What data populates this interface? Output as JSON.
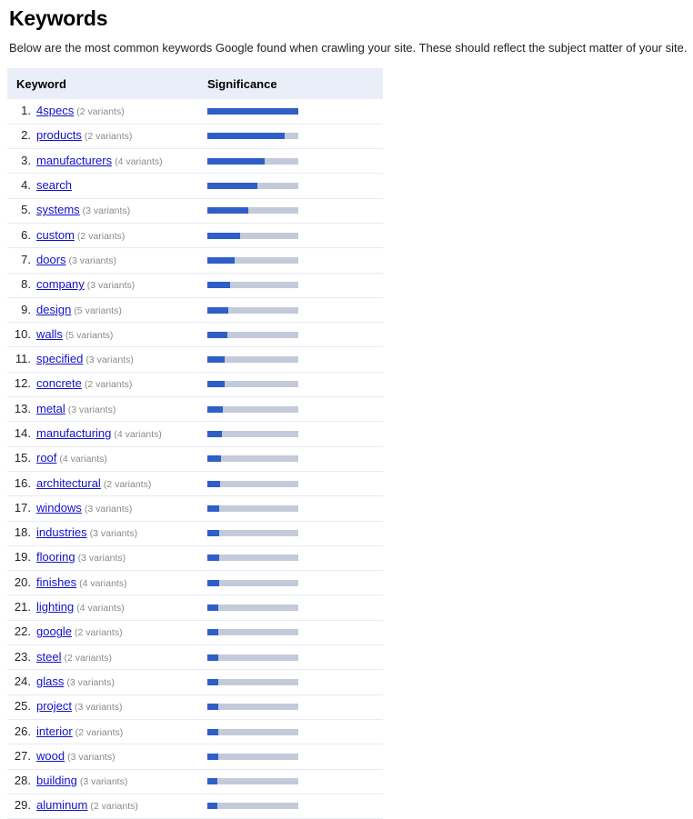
{
  "page": {
    "title": "Keywords",
    "description": "Below are the most common keywords Google found when crawling your site. These should reflect the subject matter of your site."
  },
  "table": {
    "columns": [
      "Keyword",
      "Significance"
    ],
    "variants_suffix": "variants",
    "colors": {
      "bar_fill": "#2f5fc6",
      "bar_track": "#c3cada",
      "header_background": "#eaeef8",
      "link": "#1111cc",
      "variants_text": "#8a8a8a"
    }
  },
  "chart_data": {
    "type": "bar",
    "title": "Keywords",
    "xlabel": "Significance",
    "ylabel": "Keyword",
    "ylim": [
      0,
      100
    ],
    "grid": false,
    "legend": null,
    "orientation": "horizontal",
    "categories": [
      "4specs",
      "products",
      "manufacturers",
      "search",
      "systems",
      "custom",
      "doors",
      "company",
      "design",
      "walls",
      "specified",
      "concrete",
      "metal",
      "manufacturing",
      "roof",
      "architectural",
      "windows",
      "industries",
      "flooring",
      "finishes",
      "lighting",
      "google",
      "steel",
      "glass",
      "project",
      "interior",
      "wood",
      "building",
      "aluminum"
    ],
    "values": [
      100,
      85,
      63,
      55,
      45,
      36,
      30,
      25,
      23,
      22,
      19,
      19,
      17,
      16,
      15,
      14,
      13,
      13,
      12.5,
      12.5,
      12,
      12,
      12,
      12,
      11.5,
      11.5,
      11.5,
      11,
      11
    ]
  },
  "rows": [
    {
      "rank": "1.",
      "keyword": "4specs",
      "variants": "(2 variants)",
      "significance": 100
    },
    {
      "rank": "2.",
      "keyword": "products",
      "variants": "(2 variants)",
      "significance": 85
    },
    {
      "rank": "3.",
      "keyword": "manufacturers",
      "variants": "(4 variants)",
      "significance": 63
    },
    {
      "rank": "4.",
      "keyword": "search",
      "variants": "",
      "significance": 55
    },
    {
      "rank": "5.",
      "keyword": "systems",
      "variants": "(3 variants)",
      "significance": 45
    },
    {
      "rank": "6.",
      "keyword": "custom",
      "variants": "(2 variants)",
      "significance": 36
    },
    {
      "rank": "7.",
      "keyword": "doors",
      "variants": "(3 variants)",
      "significance": 30
    },
    {
      "rank": "8.",
      "keyword": "company",
      "variants": "(3 variants)",
      "significance": 25
    },
    {
      "rank": "9.",
      "keyword": "design",
      "variants": "(5 variants)",
      "significance": 23
    },
    {
      "rank": "10.",
      "keyword": "walls",
      "variants": "(5 variants)",
      "significance": 22
    },
    {
      "rank": "11.",
      "keyword": "specified",
      "variants": "(3 variants)",
      "significance": 19
    },
    {
      "rank": "12.",
      "keyword": "concrete",
      "variants": "(2 variants)",
      "significance": 19
    },
    {
      "rank": "13.",
      "keyword": "metal",
      "variants": "(3 variants)",
      "significance": 17
    },
    {
      "rank": "14.",
      "keyword": "manufacturing",
      "variants": "(4 variants)",
      "significance": 16
    },
    {
      "rank": "15.",
      "keyword": "roof",
      "variants": "(4 variants)",
      "significance": 15
    },
    {
      "rank": "16.",
      "keyword": "architectural",
      "variants": "(2 variants)",
      "significance": 14
    },
    {
      "rank": "17.",
      "keyword": "windows",
      "variants": "(3 variants)",
      "significance": 13
    },
    {
      "rank": "18.",
      "keyword": "industries",
      "variants": "(3 variants)",
      "significance": 13
    },
    {
      "rank": "19.",
      "keyword": "flooring",
      "variants": "(3 variants)",
      "significance": 12.5
    },
    {
      "rank": "20.",
      "keyword": "finishes",
      "variants": "(4 variants)",
      "significance": 12.5
    },
    {
      "rank": "21.",
      "keyword": "lighting",
      "variants": "(4 variants)",
      "significance": 12
    },
    {
      "rank": "22.",
      "keyword": "google",
      "variants": "(2 variants)",
      "significance": 12
    },
    {
      "rank": "23.",
      "keyword": "steel",
      "variants": "(2 variants)",
      "significance": 12
    },
    {
      "rank": "24.",
      "keyword": "glass",
      "variants": "(3 variants)",
      "significance": 12
    },
    {
      "rank": "25.",
      "keyword": "project",
      "variants": "(3 variants)",
      "significance": 11.5
    },
    {
      "rank": "26.",
      "keyword": "interior",
      "variants": "(2 variants)",
      "significance": 11.5
    },
    {
      "rank": "27.",
      "keyword": "wood",
      "variants": "(3 variants)",
      "significance": 11.5
    },
    {
      "rank": "28.",
      "keyword": "building",
      "variants": "(3 variants)",
      "significance": 11
    },
    {
      "rank": "29.",
      "keyword": "aluminum",
      "variants": "(2 variants)",
      "significance": 11
    }
  ]
}
